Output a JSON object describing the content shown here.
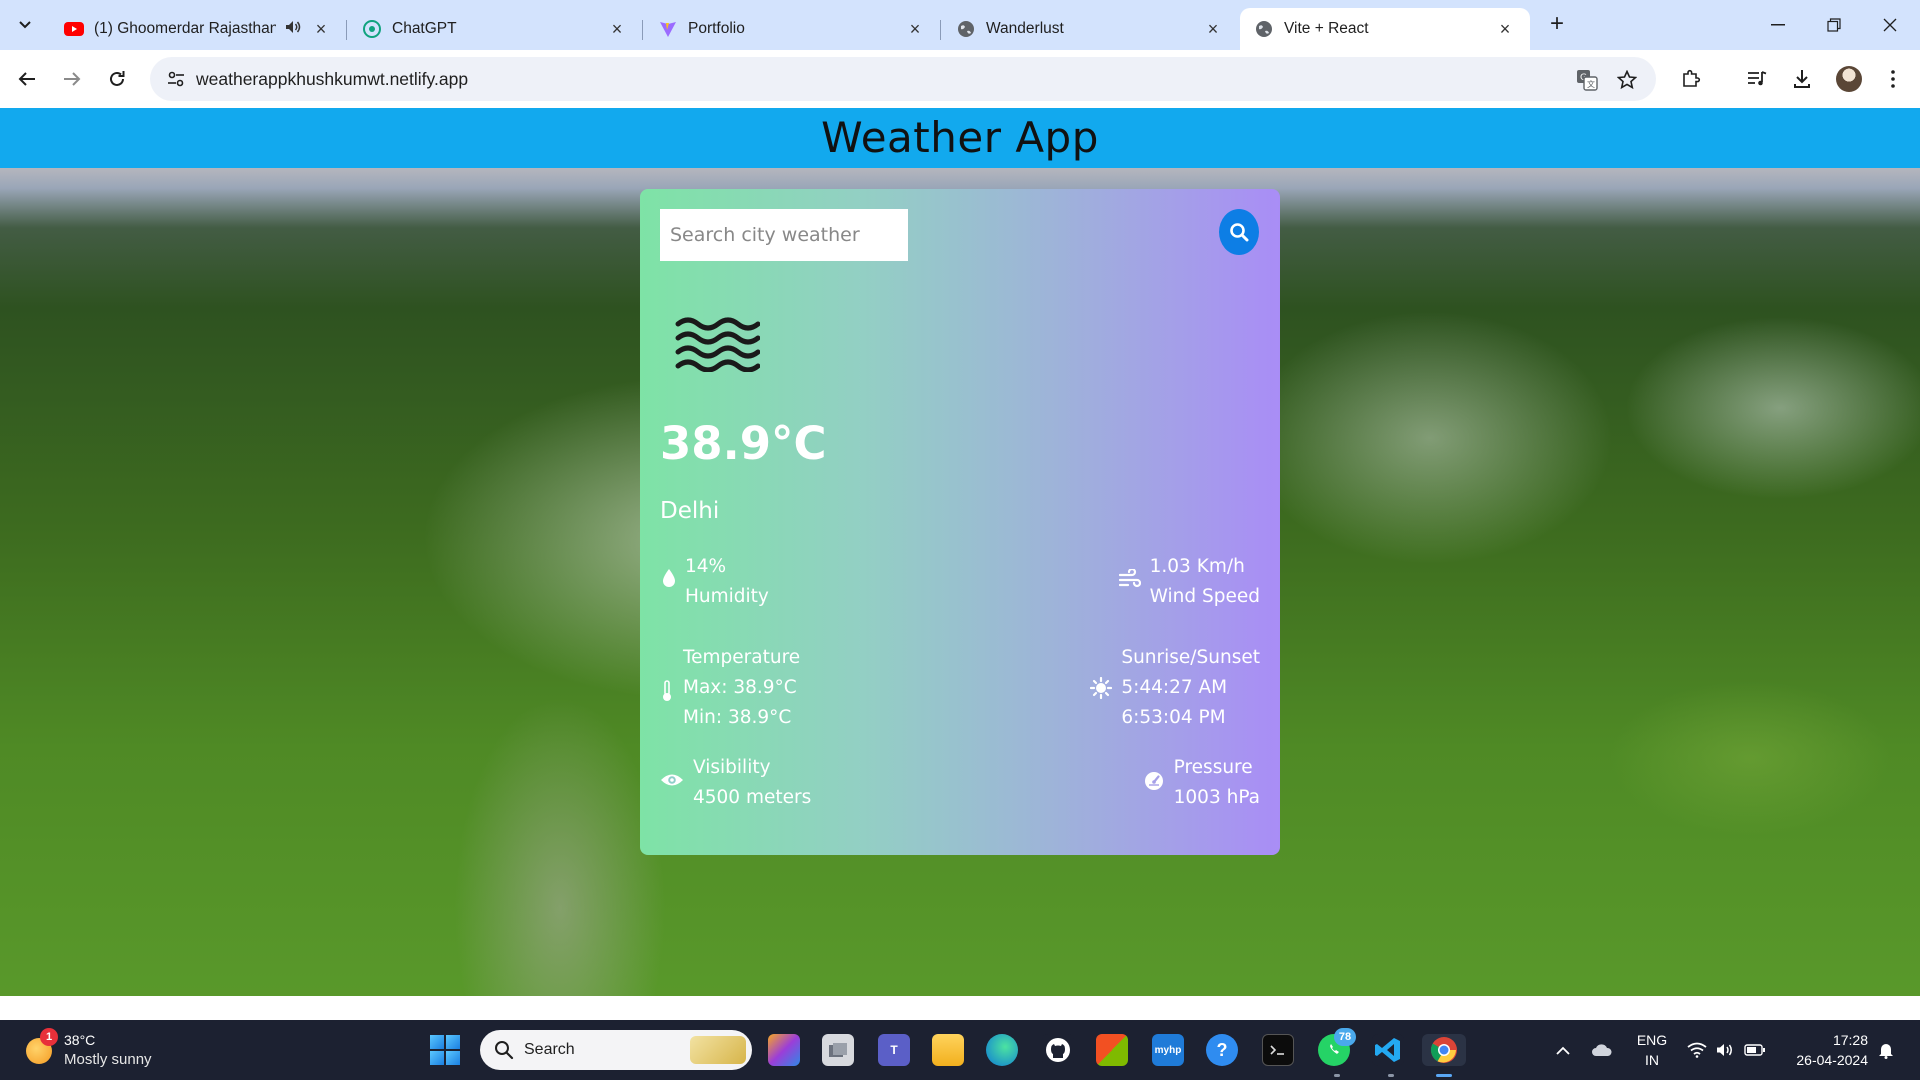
{
  "browser": {
    "tabs": [
      {
        "title": "(1) Ghoomerdar Rajasthan | ",
        "favicon": "youtube-icon"
      },
      {
        "title": "ChatGPT",
        "favicon": "chatgpt-icon"
      },
      {
        "title": "Portfolio",
        "favicon": "vite-icon"
      },
      {
        "title": "Wanderlust",
        "favicon": "globe-icon"
      },
      {
        "title": "Vite + React",
        "favicon": "globe-icon"
      }
    ],
    "active_tab_index": 4,
    "address": {
      "url": "weatherappkhushkumwt.netlify.app"
    }
  },
  "app": {
    "title": "Weather App",
    "search": {
      "placeholder": "Search city weather",
      "value": ""
    },
    "weather": {
      "condition_icon": "haze-icon",
      "temperature": "38.9°C",
      "city": "Delhi",
      "humidity": {
        "value": "14%",
        "label": "Humidity"
      },
      "wind": {
        "value": "1.03 Km/h",
        "label": "Wind Speed"
      },
      "temp_range": {
        "label": "Temperature",
        "max": "Max: 38.9°C",
        "min": "Min: 38.9°C"
      },
      "sun": {
        "label": "Sunrise/Sunset",
        "sunrise": "5:44:27 AM",
        "sunset": "6:53:04 PM"
      },
      "visibility": {
        "label": "Visibility",
        "value": "4500 meters"
      },
      "pressure": {
        "label": "Pressure",
        "value": "1003 hPa"
      }
    },
    "colors": {
      "header": "#12a9ee",
      "card_start": "#7ee3a6",
      "card_end": "#a98df6",
      "search_button": "#0d7ee5"
    }
  },
  "taskbar": {
    "weather_widget": {
      "temp": "38°C",
      "desc": "Mostly sunny",
      "badge": "1"
    },
    "search_label": "Search",
    "whatsapp_badge": "78",
    "lang_top": "ENG",
    "lang_bottom": "IN",
    "time": "17:28",
    "date": "26-04-2024"
  }
}
